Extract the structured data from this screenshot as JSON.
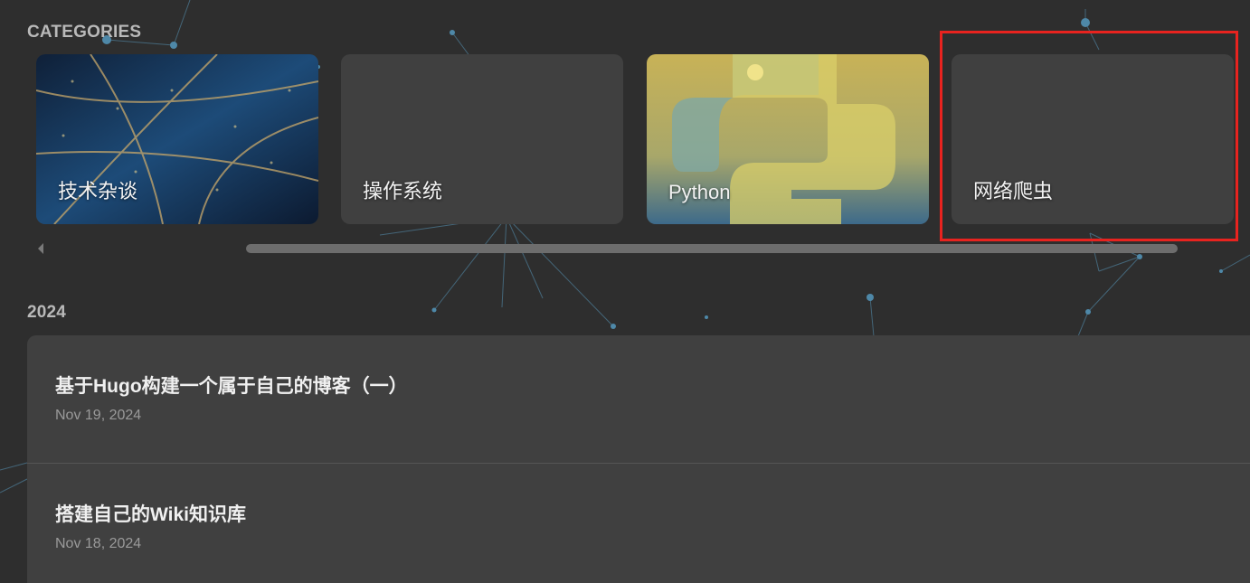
{
  "categories_heading": "CATEGORIES",
  "categories": [
    {
      "label": "技术杂谈",
      "image": "city-night-aerial"
    },
    {
      "label": "操作系统",
      "image": ""
    },
    {
      "label": "Python",
      "image": "python-logo"
    },
    {
      "label": "网络爬虫",
      "image": ""
    }
  ],
  "year_heading": "2024",
  "posts": [
    {
      "title": "基于Hugo构建一个属于自己的博客（一）",
      "date": "Nov 19, 2024"
    },
    {
      "title": "搭建自己的Wiki知识库",
      "date": "Nov 18, 2024"
    }
  ],
  "colors": {
    "background": "#2e2e2e",
    "card": "#404040",
    "highlight": "#e8231f",
    "network_dot": "#4e88a8"
  },
  "icons": {
    "scroll_left": "caret-left-icon"
  }
}
